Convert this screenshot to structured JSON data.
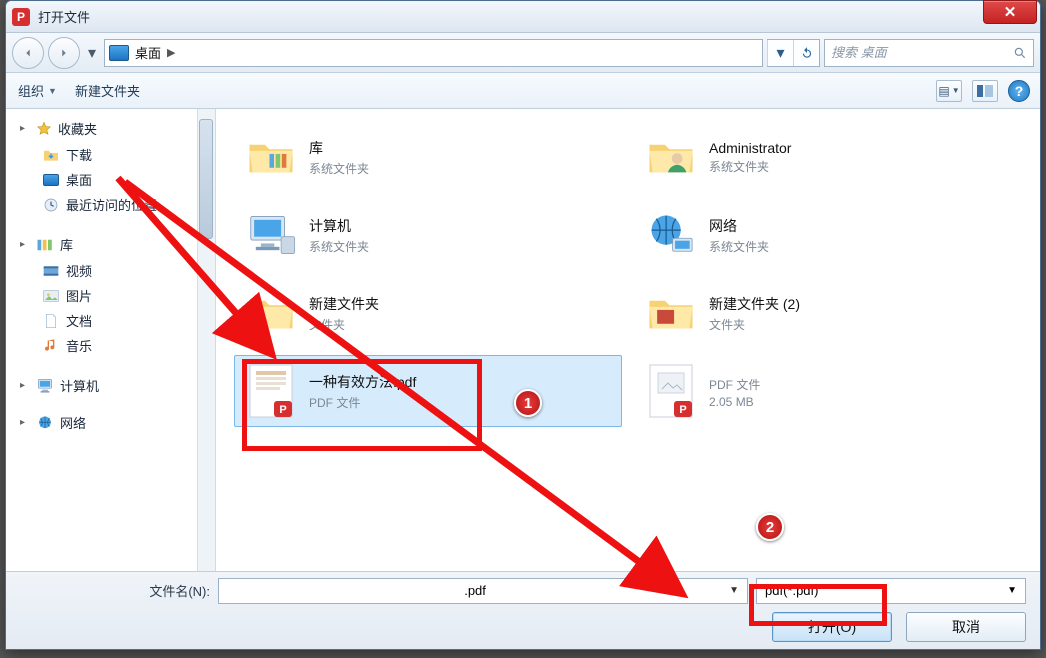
{
  "window": {
    "title": "打开文件"
  },
  "breadcrumb": {
    "location": "桌面"
  },
  "search": {
    "placeholder": "搜索 桌面"
  },
  "toolbar": {
    "organize": "组织",
    "newFolder": "新建文件夹"
  },
  "sidebar": {
    "favorites": {
      "label": "收藏夹"
    },
    "items": {
      "downloads": "下载",
      "desktop": "桌面",
      "recent": "最近访问的位置"
    },
    "libraries": {
      "label": "库"
    },
    "libItems": {
      "videos": "视频",
      "pictures": "图片",
      "documents": "文档",
      "music": "音乐"
    },
    "computer": "计算机",
    "network": "网络"
  },
  "items": {
    "libraries": {
      "title": "库",
      "sub": "系统文件夹"
    },
    "admin": {
      "title": "Administrator",
      "sub": "系统文件夹"
    },
    "computer": {
      "title": "计算机",
      "sub": "系统文件夹"
    },
    "network": {
      "title": "网络",
      "sub": "系统文件夹"
    },
    "newfolder": {
      "title": "新建文件夹",
      "sub": "文件夹"
    },
    "newfolder2": {
      "title": "新建文件夹 (2)",
      "sub": "文件夹"
    },
    "pdf1": {
      "title": "一种有效方法.pdf",
      "sub": "PDF 文件"
    },
    "pdf2": {
      "title": "",
      "sub": "PDF 文件",
      "size": "2.05 MB"
    }
  },
  "footer": {
    "fileNameLabel": "文件名(N):",
    "fileNameValue": ".pdf",
    "typeFilter": "pdf(*.pdf)",
    "open": "打开(O)",
    "cancel": "取消"
  },
  "annotations": {
    "badge1": "1",
    "badge2": "2"
  }
}
